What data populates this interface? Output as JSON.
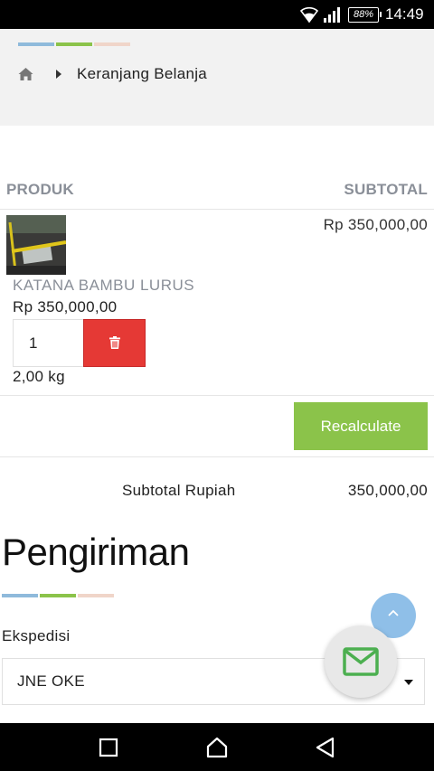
{
  "status_bar": {
    "battery": "88%",
    "time": "14:49",
    "icons": [
      "wifi-icon",
      "signal-icon",
      "battery-icon"
    ]
  },
  "breadcrumb": {
    "home_icon": "home-icon",
    "separator_icon": "caret-right-icon",
    "current": "Keranjang Belanja"
  },
  "table": {
    "headers": {
      "product": "PRODUK",
      "subtotal": "SUBTOTAL"
    },
    "items": [
      {
        "name": "KATANA BAMBU LURUS",
        "price": "Rp 350,000,00",
        "subtotal": "Rp 350,000,00",
        "quantity": "1",
        "weight": "2,00 kg",
        "delete_icon": "trash-icon"
      }
    ]
  },
  "actions": {
    "recalculate": "Recalculate"
  },
  "totals": {
    "label": "Subtotal Rupiah",
    "value": "350,000,00"
  },
  "shipping": {
    "heading": "Pengiriman",
    "courier_label": "Ekspedisi",
    "courier_selected": "JNE OKE"
  },
  "colors": {
    "stripe_blue": "#8fbadb",
    "stripe_green": "#8bc34a",
    "stripe_peach": "#f0d5c9",
    "recalculate_bg": "#8bc34a",
    "delete_bg": "#e53935",
    "scroll_top_bg": "#8fbfe8",
    "mail_icon": "#4caf50"
  },
  "floating": {
    "scroll_top_icon": "chevron-up-icon",
    "contact_icon": "mail-icon"
  },
  "nav_bar": {
    "icons": [
      "recents-icon",
      "home-button-icon",
      "back-icon"
    ]
  }
}
